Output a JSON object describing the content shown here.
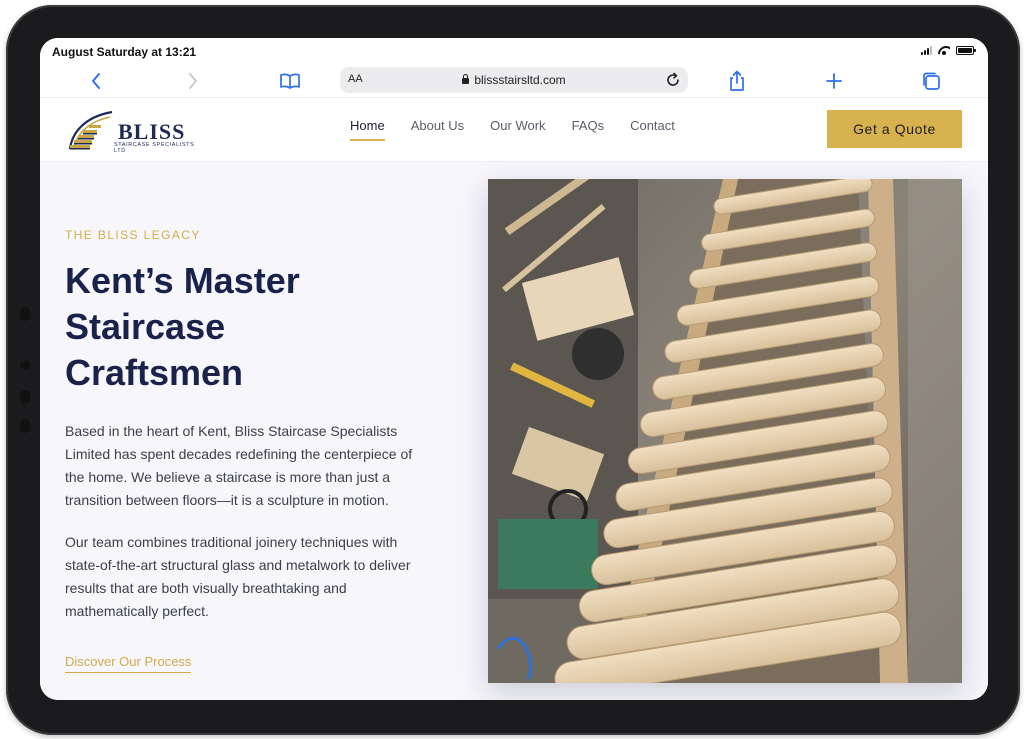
{
  "status_bar": {
    "time": "August Saturday at 13:21"
  },
  "browser": {
    "aa_label": "AA",
    "url": "blissstairsltd.com",
    "icons": [
      "back-icon",
      "forward-icon",
      "bookmarks-icon",
      "reload-icon",
      "share-icon",
      "new-tab-icon",
      "tabs-icon"
    ]
  },
  "site": {
    "logo": {
      "word": "BLISS",
      "sub": "STAIRCASE SPECIALISTS LTD"
    },
    "nav": [
      {
        "label": "Home",
        "active": true
      },
      {
        "label": "About Us",
        "active": false
      },
      {
        "label": "Our Work",
        "active": false
      },
      {
        "label": "FAQs",
        "active": false
      },
      {
        "label": "Contact",
        "active": false
      }
    ],
    "quote_button": "Get a Quote"
  },
  "hero": {
    "eyebrow": "THE BLISS LEGACY",
    "headline": "Kent’s Master Staircase Craftsmen",
    "paragraph_1": "Based in the heart of Kent, Bliss Staircase Specialists Limited has spent decades redefining the centerpiece of the home. We believe a staircase is more than just a transition between floors—it is a sculpture in motion.",
    "paragraph_2": "Our team combines traditional joinery techniques with state-of-the-art structural glass and metalwork to deliver results that are both visually breathtaking and mathematically perfect.",
    "link": "Discover Our Process"
  },
  "colors": {
    "accent_gold": "#d8b24f",
    "navy": "#18224a",
    "link_blue": "#2f6fea"
  }
}
